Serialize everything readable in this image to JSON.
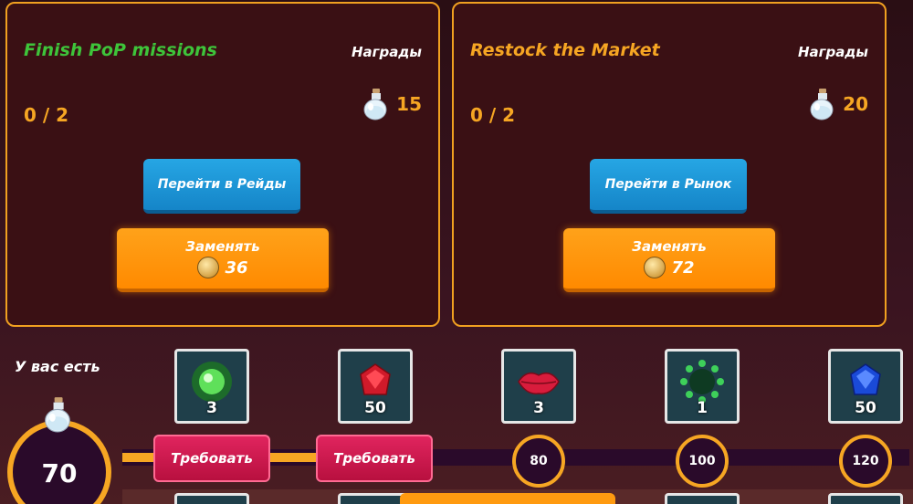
{
  "missions": [
    {
      "title": "Finish PoP missions",
      "title_color": "#3ec43a",
      "rewards_label": "Награды",
      "progress": "0 / 2",
      "reward_icon": "potion-icon",
      "reward_amount": "15",
      "go_button": "Перейти в Рейды",
      "replace_label": "Заменять",
      "replace_cost": "36",
      "cost_icon": "coin-icon"
    },
    {
      "title": "Restock the Market",
      "title_color": "#f6a623",
      "rewards_label": "Награды",
      "progress": "0 / 2",
      "reward_icon": "potion-icon",
      "reward_amount": "20",
      "go_button": "Перейти в Рынок",
      "replace_label": "Заменять",
      "replace_cost": "72",
      "cost_icon": "coin-icon"
    }
  ],
  "progress_track": {
    "have_label": "У вас есть",
    "have_amount": "70",
    "tiers": [
      {
        "icon": "green-orb-icon",
        "qty": "3",
        "claim": "Требовать"
      },
      {
        "icon": "red-gem-icon",
        "qty": "50",
        "claim": "Требовать"
      },
      {
        "icon": "lips-icon",
        "qty": "3",
        "threshold": "80"
      },
      {
        "icon": "clover-ring-icon",
        "qty": "1",
        "threshold": "100"
      },
      {
        "icon": "blue-gem-icon",
        "qty": "50",
        "threshold": "120"
      }
    ]
  },
  "colors": {
    "accent": "#f6a623",
    "panel_border": "#f0a020",
    "blue_button": "#1f97d8",
    "orange_button": "#ff9500",
    "claim_button": "#d21a50"
  }
}
